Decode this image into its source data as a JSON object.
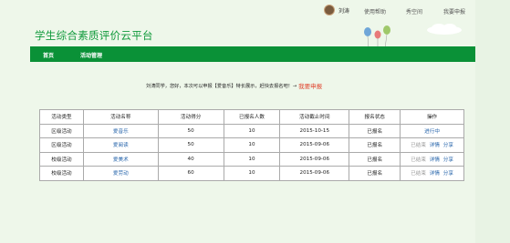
{
  "topbar": {
    "user_name": "刘涛",
    "links": [
      "使用帮助",
      "秀空间",
      "我要申报"
    ]
  },
  "header": {
    "title": "学生综合素质评价云平台"
  },
  "nav": {
    "items": [
      "首页",
      "活动管理"
    ]
  },
  "notice": {
    "text": "刘涛同学，您好，本次可以申报【爱音乐】特长展示，赶快去报名吧！→",
    "link": "我要申报"
  },
  "table": {
    "headers": [
      "活动类型",
      "活动名称",
      "活动得分",
      "已报名人数",
      "活动截止时间",
      "报名状态",
      "操作"
    ],
    "rows": [
      {
        "type": "区级活动",
        "name": "爱音乐",
        "score": "50",
        "count": "10",
        "deadline": "2015-10-15",
        "status": "已报名",
        "ops": [
          "进行中"
        ]
      },
      {
        "type": "区级活动",
        "name": "爱阅读",
        "score": "50",
        "count": "10",
        "deadline": "2015-09-06",
        "status": "已报名",
        "ops": [
          "已结束",
          "详情",
          "分享"
        ]
      },
      {
        "type": "校级活动",
        "name": "爱美术",
        "score": "40",
        "count": "10",
        "deadline": "2015-09-06",
        "status": "已报名",
        "ops": [
          "已结束",
          "详情",
          "分享"
        ]
      },
      {
        "type": "校级活动",
        "name": "爱劳动",
        "score": "60",
        "count": "10",
        "deadline": "2015-09-06",
        "status": "已报名",
        "ops": [
          "已结束",
          "详情",
          "分享"
        ]
      }
    ]
  },
  "colors": {
    "brand_green": "#0a9137",
    "title_green": "#119a3c",
    "link_blue": "#1f5fa8",
    "alert_red": "#e0442e",
    "background": "#eef7ea"
  }
}
